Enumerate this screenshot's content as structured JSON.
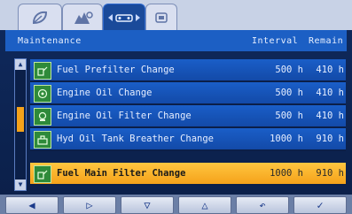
{
  "tabs": [
    {
      "icon": "leaf-icon"
    },
    {
      "icon": "machine-settings-icon"
    },
    {
      "icon": "maintenance-icon",
      "active": true
    },
    {
      "icon": "screen-icon"
    }
  ],
  "table": {
    "columns": {
      "name": "Maintenance",
      "interval": "Interval",
      "remain": "Remain"
    },
    "rows": [
      {
        "icon": "fuel-filter-icon",
        "name": "Fuel Prefilter Change",
        "interval": "500 h",
        "remain": "410 h"
      },
      {
        "icon": "oil-can-icon",
        "name": "Engine Oil Change",
        "interval": "500 h",
        "remain": "410 h"
      },
      {
        "icon": "oil-filter-icon",
        "name": "Engine Oil Filter Change",
        "interval": "500 h",
        "remain": "410 h"
      },
      {
        "icon": "breather-icon",
        "name": "Hyd Oil Tank Breather Change",
        "interval": "1000 h",
        "remain": "910 h"
      },
      {
        "icon": "fuel-filter-icon",
        "name": "Fuel Main Filter Change",
        "interval": "1000 h",
        "remain": "910 h",
        "selected": true
      }
    ]
  },
  "scrollbar": {
    "position_fraction": 0.4
  },
  "buttons": [
    {
      "icon": "left-arrow-icon",
      "glyph": "◀"
    },
    {
      "icon": "right-arrow-icon",
      "glyph": "▷"
    },
    {
      "icon": "down-arrow-icon",
      "glyph": "▽"
    },
    {
      "icon": "up-arrow-icon",
      "glyph": "△"
    },
    {
      "icon": "return-icon",
      "glyph": "↶"
    },
    {
      "icon": "check-icon",
      "glyph": "✓"
    }
  ],
  "colors": {
    "accent": "#f5a21a",
    "header": "#1c5fc4",
    "row": "#1a5ec8"
  }
}
